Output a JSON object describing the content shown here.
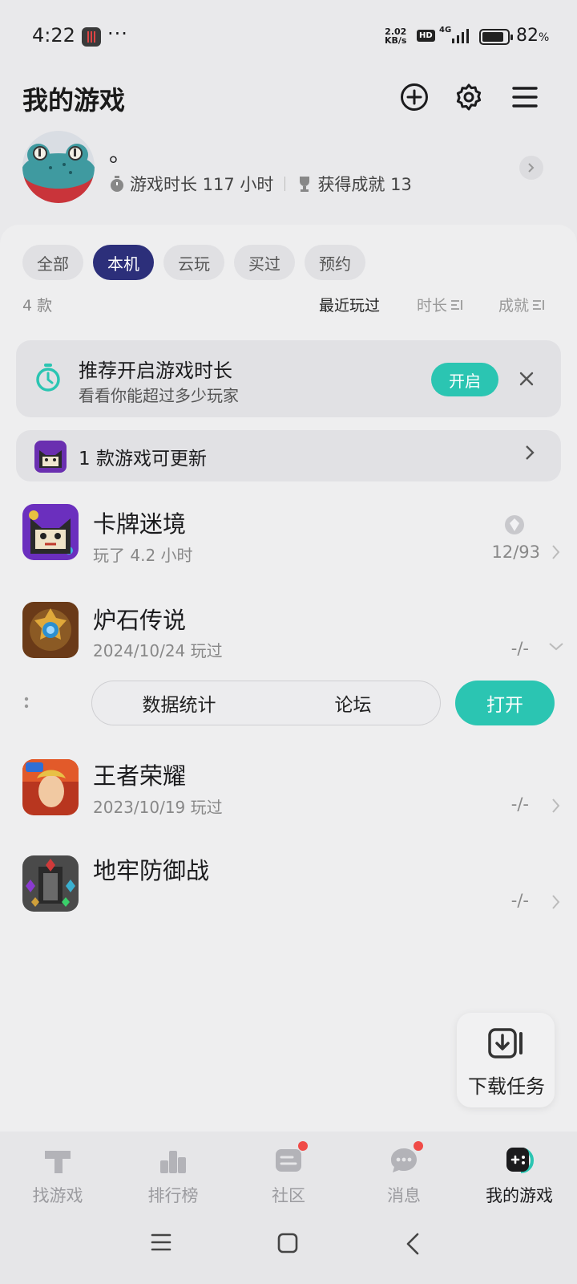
{
  "status_bar": {
    "time": "4:22",
    "dots": "···",
    "speed_value": "2.02",
    "speed_unit": "KB/s",
    "hd": "HD",
    "network": "4G",
    "battery_pct": "82",
    "battery_unit": "%"
  },
  "header": {
    "title": "我的游戏"
  },
  "profile": {
    "nickname": "。",
    "playtime": "游戏时长 117 小时",
    "achievements": "获得成就 13"
  },
  "filters": {
    "tabs": [
      "全部",
      "本机",
      "云玩",
      "买过",
      "预约"
    ],
    "active_index": 1
  },
  "list_meta": {
    "count": "4 款",
    "sort_recent": "最近玩过",
    "sort_duration": "时长",
    "sort_achievement": "成就"
  },
  "recommend": {
    "title": "推荐开启游戏时长",
    "subtitle": "看看你能超过多少玩家",
    "button": "开启"
  },
  "update_banner": {
    "text": "1 款游戏可更新"
  },
  "games": [
    {
      "name": "卡牌迷境",
      "sub": "玩了 4.2 小时",
      "achievement": "12/93"
    },
    {
      "name": "炉石传说",
      "sub": "2024/10/24 玩过",
      "achievement": "-/-"
    },
    {
      "name": "王者荣耀",
      "sub": "2023/10/19 玩过",
      "achievement": "-/-"
    },
    {
      "name": "地牢防御战",
      "sub": "",
      "achievement": "-/-"
    }
  ],
  "expanded_actions": {
    "stats": "数据统计",
    "forum": "论坛",
    "open": "打开"
  },
  "download_fab": {
    "label": "下载任务"
  },
  "bottom_nav": {
    "items": [
      "找游戏",
      "排行榜",
      "社区",
      "消息",
      "我的游戏"
    ],
    "active_index": 4
  },
  "colors": {
    "accent": "#2bc5b2",
    "active_tab": "#2c2f7a",
    "badge": "#f04b47"
  }
}
